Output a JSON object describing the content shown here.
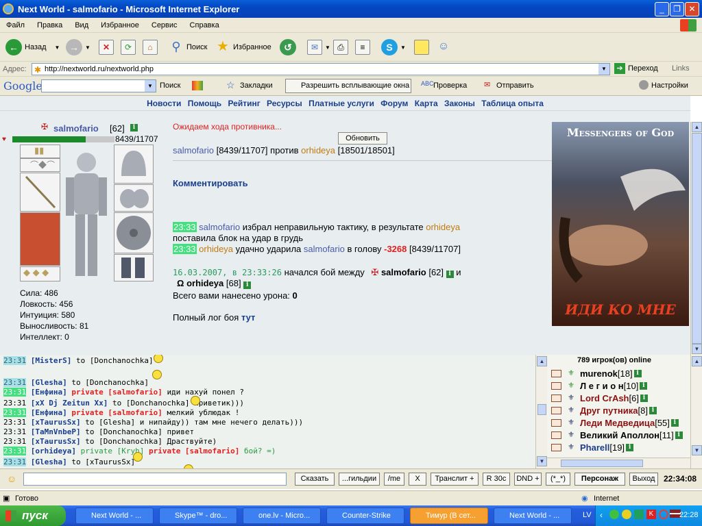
{
  "window": {
    "title": "Next World - salmofario - Microsoft Internet Explorer"
  },
  "menu": [
    "Файл",
    "Правка",
    "Вид",
    "Избранное",
    "Сервис",
    "Справка"
  ],
  "toolbar": {
    "back": "Назад",
    "search": "Поиск",
    "favorites": "Избранное"
  },
  "address": {
    "label": "Адрес:",
    "url": "http://nextworld.ru/nextworld.php",
    "go": "Переход",
    "links": "Links"
  },
  "google": {
    "logo": "Google",
    "search": "Поиск",
    "bookmarks": "Закладки",
    "popups": "Разрешить всплывающие окна",
    "check": "Проверка",
    "send": "Отправить",
    "settings": "Настройки"
  },
  "nav": [
    "Новости",
    "Помощь",
    "Рейтинг",
    "Ресурсы",
    "Платные услуги",
    "Форум",
    "Карта",
    "Законы",
    "Таблица опыта"
  ],
  "player": {
    "name": "salmofario",
    "level": "[62]",
    "hp": "8439/11707",
    "hp_fraction": 0.72,
    "stats": [
      "Сила: 486",
      "Ловкость: 456",
      "Интуиция: 580",
      "Выносливость: 81",
      "Интеллект: 0"
    ]
  },
  "battle": {
    "waiting": "Ожидаем хода противника...",
    "refresh": "Обновить",
    "p1": "salmofario",
    "p1_hp": "[8439/11707]",
    "vs": "против",
    "p2": "orhideya",
    "p2_hp": "[18501/18501]",
    "comment": "Комментировать",
    "log1_time": "23:33",
    "log1_a": "salmofario",
    "log1_b": "избрал неправильную тактику, в результате",
    "log1_c": "orhideya",
    "log1_d": "поставила блок на удар в грудь",
    "log2_time": "23:33",
    "log2_a": "orhideya",
    "log2_b": "удачно ударила",
    "log2_c": "salmofario",
    "log2_d": "в голову",
    "log2_dmg": "-3268",
    "log2_hp": "[8439/11707]",
    "start_date": "16.03.2007, в 23:33:26",
    "start_text": "начался бой между",
    "start_p1": "salmofario",
    "start_p1_lvl": "[62]",
    "and": "и",
    "start_p2": "orhideya",
    "start_p2_lvl": "[68]",
    "damage_label": "Всего вами нанесено урона:",
    "damage_value": "0",
    "full_log": "Полный лог боя",
    "here": "тут"
  },
  "banner": {
    "top": "Messengers of God",
    "bottom": "ИДИ КО МНЕ"
  },
  "chat": [
    {
      "time": "23:31",
      "ts": "c",
      "nick": "[MisterS]",
      "rest": "to [Donchanochka]"
    },
    {
      "time": "23:31",
      "ts": "c",
      "nick": "[Glesha]",
      "rest": "to [Donchanochka]"
    },
    {
      "time": "23:31",
      "ts": "g",
      "nick": "[Енфина]",
      "priv": "private [salmofario]",
      "rest": "иди нахуй понел ?"
    },
    {
      "time": "23:31",
      "ts": "n",
      "nick": "[xX Dj Zeitun Xx]",
      "rest": "to [Donchanochka]   приветик)))"
    },
    {
      "time": "23:31",
      "ts": "g",
      "nick": "[Енфина]",
      "priv": "private [salmofario]",
      "rest": "мелкий ублюдак !"
    },
    {
      "time": "23:31",
      "ts": "n",
      "nick": "[xTaurusSx]",
      "rest": "to [Glesha] и нипайду)) там мне нечего делать)))"
    },
    {
      "time": "23:31",
      "ts": "n",
      "nick": "[TaMnVnbeP]",
      "rest": "to [Donchanochka] привет"
    },
    {
      "time": "23:31",
      "ts": "n",
      "nick": "[xTaurusSx]",
      "rest": "to [Donchanochka] Драствуйте)"
    },
    {
      "time": "23:31",
      "ts": "g",
      "nick": "[orhideya]",
      "priv2": "private [Kryh]",
      "priv": "private [salmofario]",
      "rest": "бой? =)"
    },
    {
      "time": "23:31",
      "ts": "c",
      "nick": "[Glesha]",
      "rest": "to [xTaurusSx]"
    }
  ],
  "online": {
    "count": "789 игрок(ов) online",
    "users": [
      {
        "name": "murenok",
        "lvl": "[18]",
        "color": "#000"
      },
      {
        "name": "Л е г и о н",
        "lvl": "[10]",
        "color": "#000"
      },
      {
        "name": "Lord CrAsh",
        "lvl": "[6]",
        "color": "#8a1010"
      },
      {
        "name": "Друг путника",
        "lvl": "[8]",
        "color": "#8a1010"
      },
      {
        "name": "Леди Медведица",
        "lvl": "[55]",
        "color": "#8a1010"
      },
      {
        "name": "Великий Аполлон",
        "lvl": "[11]",
        "color": "#000"
      },
      {
        "name": "Pharell",
        "lvl": "[19]",
        "color": "#1a3e8c"
      }
    ]
  },
  "inputbar": {
    "say": "Сказать",
    "guild": "...гильдии",
    "me": "/me",
    "x": "X",
    "translit": "Транслит +",
    "r30": "R 30c",
    "dnd": "DND +",
    "smile": "(*_*)",
    "persona": "Персонаж",
    "exit": "Выход",
    "time": "22:34:08"
  },
  "status": {
    "ready": "Готово",
    "zone": "Internet"
  },
  "taskbar": {
    "start": "пуск",
    "tasks": [
      "Next World - ...",
      "Skype™ - dro...",
      "one.lv - Micro...",
      "Counter-Strike",
      "Тимур (В сет...",
      "Next World - ..."
    ],
    "lang": "LV",
    "clock": "22:28"
  }
}
